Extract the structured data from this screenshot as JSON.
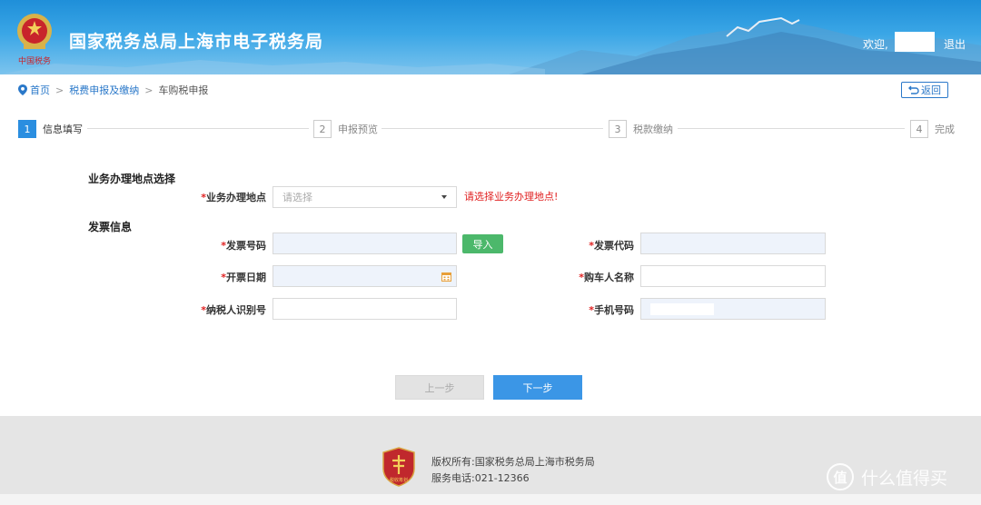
{
  "header": {
    "site_title": "国家税务总局上海市电子税务局",
    "welcome_text": "欢迎,",
    "logout_label": "退出",
    "emblem_caption": "中国税务"
  },
  "breadcrumb": {
    "home": "首页",
    "level2": "税费申报及缴纳",
    "current": "车购税申报",
    "separator": ">",
    "back_label": "返回"
  },
  "steps": [
    {
      "num": "1",
      "label": "信息填写",
      "active": true
    },
    {
      "num": "2",
      "label": "申报预览",
      "active": false
    },
    {
      "num": "3",
      "label": "税款缴纳",
      "active": false
    },
    {
      "num": "4",
      "label": "完成",
      "active": false
    }
  ],
  "form": {
    "location_section_title": "业务办理地点选择",
    "location_label": "业务办理地点",
    "location_placeholder": "请选择",
    "location_error": "请选择业务办理地点!",
    "invoice_section_title": "发票信息",
    "required_mark": "*",
    "invoice_number_label": "发票号码",
    "import_label": "导入",
    "invoice_code_label": "发票代码",
    "issue_date_label": "开票日期",
    "buyer_name_label": "购车人名称",
    "taxpayer_id_label": "纳税人识别号",
    "phone_label": "手机号码"
  },
  "actions": {
    "prev_label": "上一步",
    "next_label": "下一步"
  },
  "footer": {
    "copyright": "版权所有:国家税务总局上海市税务局",
    "phone": "服务电话:021-12366",
    "logo_caption": "税收筹划"
  },
  "watermark": {
    "icon_char": "值",
    "text": "什么值得买"
  },
  "colors": {
    "header_blue": "#2a8ee0",
    "link_blue": "#2a78c9",
    "error_red": "#e02020",
    "import_green": "#4cb86b",
    "next_blue": "#3b96e6"
  }
}
